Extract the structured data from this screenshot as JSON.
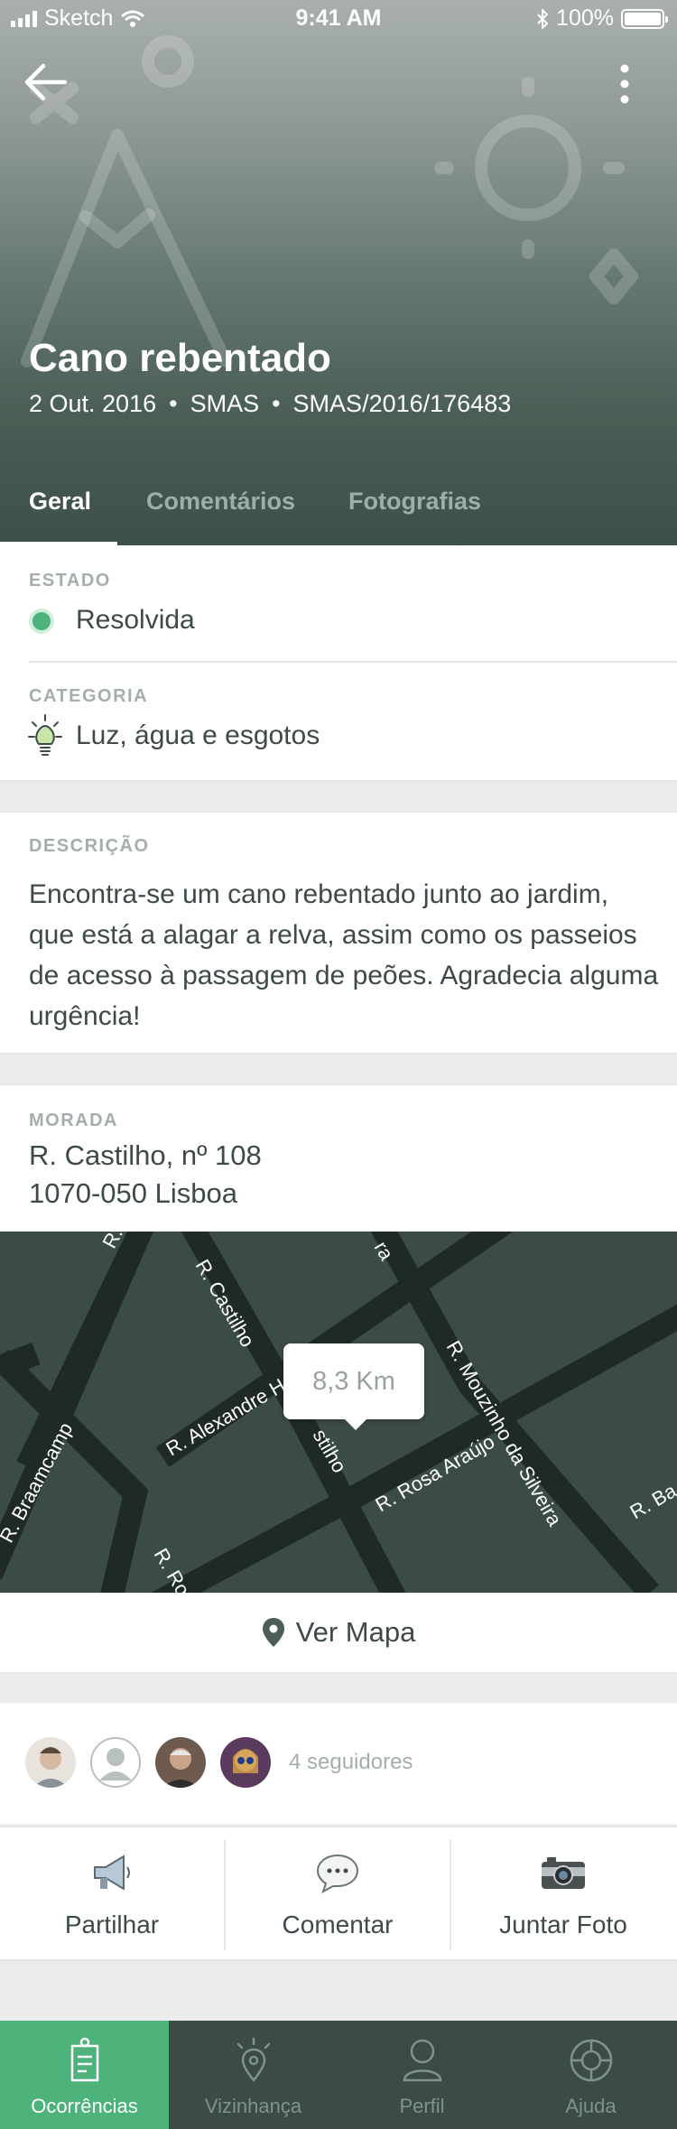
{
  "status_bar": {
    "carrier": "Sketch",
    "time": "9:41 AM",
    "battery": "100%"
  },
  "header": {
    "title": "Cano rebentado",
    "date": "2 Out. 2016",
    "entity": "SMAS",
    "reference": "SMAS/2016/176483",
    "separator": "•"
  },
  "tabs": [
    {
      "label": "Geral",
      "active": true
    },
    {
      "label": "Comentários",
      "active": false
    },
    {
      "label": "Fotografias",
      "active": false
    }
  ],
  "estado": {
    "label": "ESTADO",
    "value": "Resolvida",
    "color": "#4db37a"
  },
  "categoria": {
    "label": "CATEGORIA",
    "value": "Luz, água e esgotos",
    "icon": "lightbulb-icon"
  },
  "descricao": {
    "label": "DESCRIÇÃO",
    "text": "Encontra-se um cano rebentado junto ao jardim, que está a alagar a relva, assim como os passeios de acesso à passagem de peões. Agradecia alguma urgência!"
  },
  "morada": {
    "label": "MORADA",
    "line1": "R. Castilho, nº 108",
    "line2": "1070-050 Lisboa"
  },
  "map": {
    "distance": "8,3 Km",
    "streets": [
      "R. Braamcamp",
      "R. Castilho",
      "R. Alexandre Herculano",
      "R. Mouzinho da Silveira",
      "R. Rosa Araújo",
      "stilho",
      "R. Ba",
      "R. Ro",
      "R.",
      "ra"
    ]
  },
  "ver_mapa": {
    "label": "Ver Mapa",
    "icon": "map-pin-icon"
  },
  "followers": {
    "count_text": "4 seguidores"
  },
  "actions": [
    {
      "label": "Partilhar",
      "icon": "megaphone-icon"
    },
    {
      "label": "Comentar",
      "icon": "chat-bubble-icon"
    },
    {
      "label": "Juntar Foto",
      "icon": "camera-icon"
    }
  ],
  "bottom_nav": [
    {
      "label": "Ocorrências",
      "icon": "clipboard-icon",
      "active": true
    },
    {
      "label": "Vizinhança",
      "icon": "location-icon",
      "active": false
    },
    {
      "label": "Perfil",
      "icon": "user-icon",
      "active": false
    },
    {
      "label": "Ajuda",
      "icon": "lifebuoy-icon",
      "active": false
    }
  ],
  "colors": {
    "primary": "#3b4c44",
    "accent": "#4db37a"
  }
}
